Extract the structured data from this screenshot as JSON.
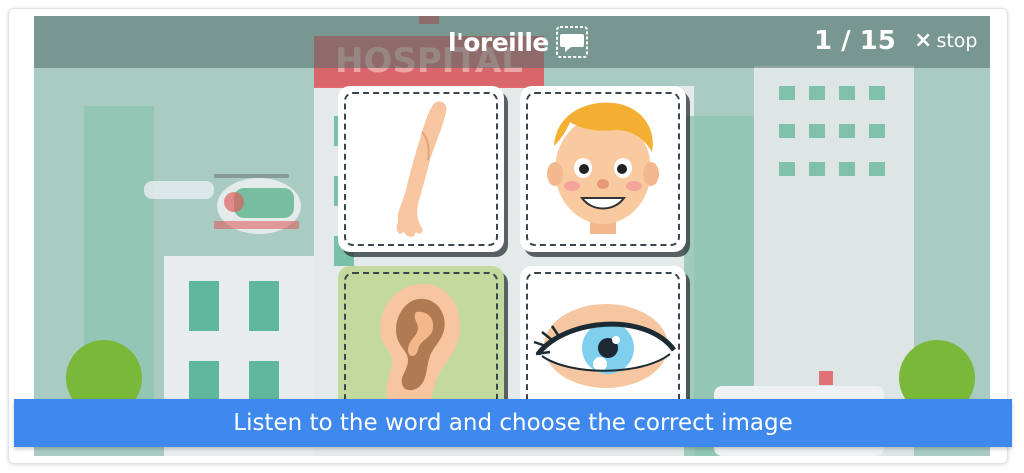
{
  "header": {
    "word": "l'oreille",
    "speech_icon": "speech-bubble-icon",
    "progress": "1 / 15",
    "stop_label": "stop",
    "stop_icon": "close-icon"
  },
  "background": {
    "sign_text": "HOSPITAL"
  },
  "cards": [
    {
      "id": "arm",
      "icon": "arm-image"
    },
    {
      "id": "face",
      "icon": "face-image"
    },
    {
      "id": "ear",
      "icon": "ear-image"
    },
    {
      "id": "eye",
      "icon": "eye-image"
    }
  ],
  "instruction": "Listen to the word and choose the correct image",
  "colors": {
    "instruction_bar": "#3f88ee",
    "ear_card": "#c3d99e",
    "card_border": "#3a4550"
  }
}
